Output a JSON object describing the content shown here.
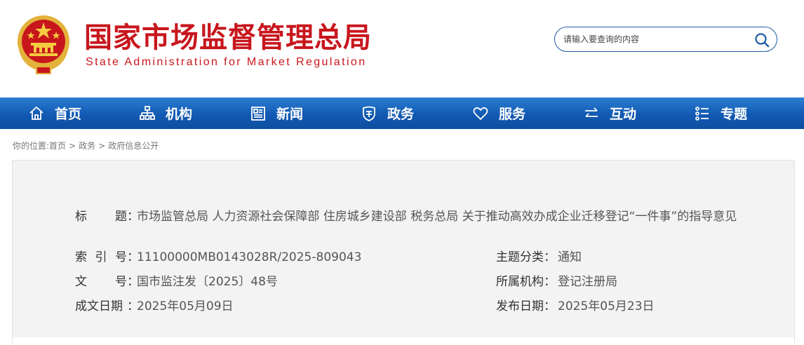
{
  "header": {
    "title": "国家市场监督管理总局",
    "subtitle": "State Administration for Market Regulation",
    "search": {
      "placeholder": "请输入要查询的内容"
    }
  },
  "nav": {
    "items": [
      {
        "label": "首页",
        "icon": "home-icon"
      },
      {
        "label": "机构",
        "icon": "org-chart-icon"
      },
      {
        "label": "新闻",
        "icon": "news-icon"
      },
      {
        "label": "政务",
        "icon": "government-shield-icon"
      },
      {
        "label": "服务",
        "icon": "heart-icon"
      },
      {
        "label": "互动",
        "icon": "exchange-arrows-icon"
      },
      {
        "label": "专题",
        "icon": "topics-list-icon"
      }
    ]
  },
  "breadcrumb": {
    "prefix": "你的位置:",
    "items": [
      "首页",
      "政务",
      "政府信息公开"
    ],
    "separator": ">"
  },
  "info": {
    "title_label_chars": [
      "标",
      "题"
    ],
    "title_value": "市场监管总局 人力资源社会保障部 住房城乡建设部 税务总局 关于推动高效办成企业迁移登记“一件事”的指导意见",
    "index_label_chars": [
      "索",
      "引",
      "号"
    ],
    "index_value": "11100000MB0143028R/2025-809043",
    "doc_no_label_chars": [
      "文",
      "号"
    ],
    "doc_no_value": "国市监注发〔2025〕48号",
    "written_date_label": "成文日期",
    "written_date_value": "2025年05月09日",
    "topic_label": "主题分类",
    "topic_value": "通知",
    "agency_label": "所属机构",
    "agency_value": "登记注册局",
    "publish_date_label": "发布日期",
    "publish_date_value": "2025年05月23日",
    "colon": "："
  },
  "colors": {
    "brand_red": "#c8161d",
    "nav_blue": "#1259b2",
    "panel_bg": "#f3f3f3"
  }
}
